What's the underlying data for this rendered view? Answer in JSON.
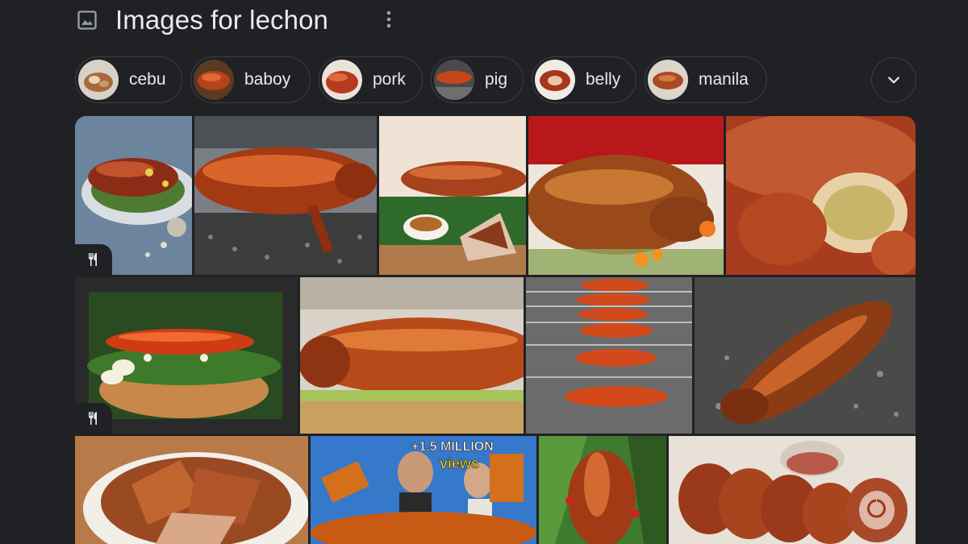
{
  "header": {
    "title": "Images for lechon",
    "image_icon": "image-icon",
    "more_icon": "more-vert-icon"
  },
  "chips": [
    {
      "label": "cebu"
    },
    {
      "label": "baboy"
    },
    {
      "label": "pork"
    },
    {
      "label": "pig"
    },
    {
      "label": "belly"
    },
    {
      "label": "manila"
    }
  ],
  "expand_icon": "chevron-down-icon",
  "recipe_badge_icon": "fork-knife-icon",
  "thumbnail_overlay": {
    "views_line1": "+1.5 MILLION",
    "views_line2": "views"
  },
  "colors": {
    "background": "#202124",
    "text": "#e8eaed",
    "chip_border": "#3c4043",
    "roast_brown": "#9a3b12",
    "roast_highlight": "#d9652a"
  }
}
